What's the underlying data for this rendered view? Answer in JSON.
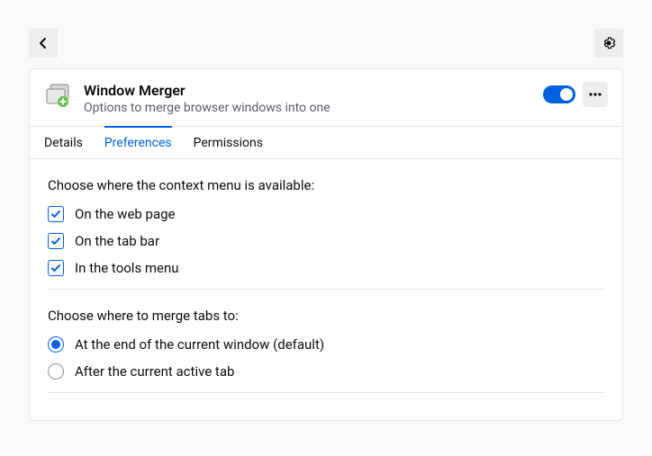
{
  "extension": {
    "name": "Window Merger",
    "description": "Options to merge browser windows into one"
  },
  "tabs": {
    "details": "Details",
    "preferences": "Preferences",
    "permissions": "Permissions"
  },
  "section1": {
    "heading": "Choose where the context menu is available:",
    "options": [
      {
        "label": "On the web page",
        "checked": true
      },
      {
        "label": "On the tab bar",
        "checked": true
      },
      {
        "label": "In the tools menu",
        "checked": true
      }
    ]
  },
  "section2": {
    "heading": "Choose where to merge tabs to:",
    "options": [
      {
        "label": "At the end of the current window (default)",
        "checked": true
      },
      {
        "label": "After the current active tab",
        "checked": false
      }
    ]
  }
}
